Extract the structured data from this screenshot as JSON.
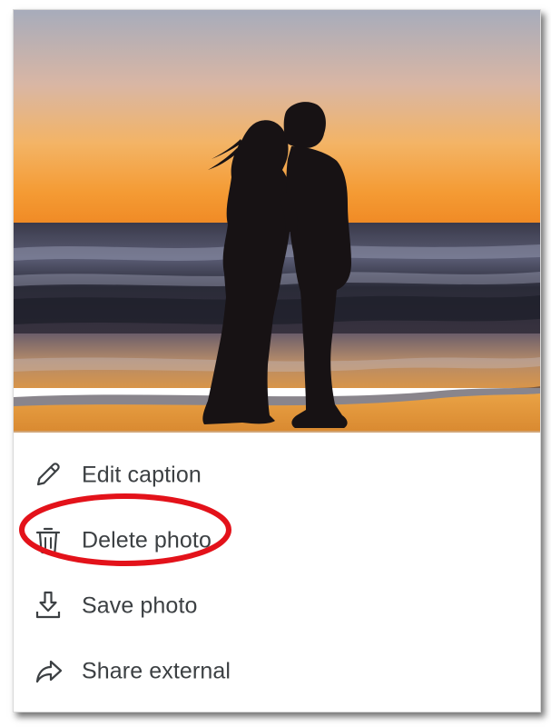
{
  "menu": {
    "items": [
      {
        "label": "Edit caption",
        "icon": "pencil-icon"
      },
      {
        "label": "Delete photo",
        "icon": "trash-icon"
      },
      {
        "label": "Save photo",
        "icon": "download-icon"
      },
      {
        "label": "Share external",
        "icon": "share-arrow-icon"
      }
    ]
  },
  "colors": {
    "text": "#3c4043",
    "highlight": "#e3121a",
    "sky_top": "#9fa6b8",
    "sky_horizon": "#f59a2a",
    "sea": "#2b2d3e",
    "sand": "#e49335"
  }
}
